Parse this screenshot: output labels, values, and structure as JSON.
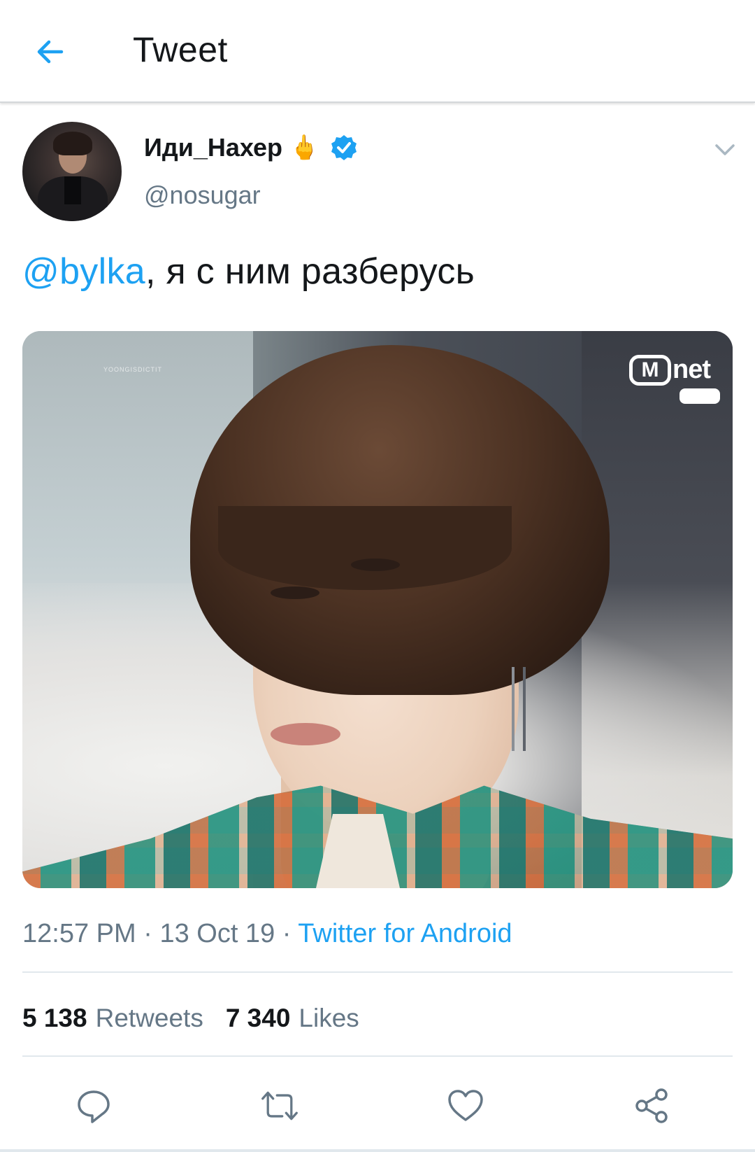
{
  "header": {
    "title": "Tweet"
  },
  "tweet": {
    "author": {
      "display_name": "Иди_Нахер",
      "emoji": "🖕",
      "handle": "@nosugar",
      "verified": true
    },
    "text": {
      "mention": "@bylka",
      "body": ", я с ним разберусь"
    },
    "media": {
      "logo_text": "Mnet",
      "logo_m": "M",
      "logo_net": "net",
      "watermark": "YOONGISDICTIT"
    },
    "meta": {
      "time": "12:57 PM",
      "separator": " · ",
      "date": "13 Oct 19",
      "source": "Twitter for Android"
    },
    "stats": {
      "retweets_count": "5 138",
      "retweets_label": "Retweets",
      "likes_count": "7 340",
      "likes_label": "Likes"
    }
  },
  "colors": {
    "accent": "#1da1f2",
    "text_primary": "#14171a",
    "text_secondary": "#657786",
    "divider": "#e1e8ed"
  },
  "icons": {
    "back": "arrow-left-icon",
    "verified": "verified-badge-icon",
    "caret": "chevron-down-icon",
    "reply": "reply-icon",
    "retweet": "retweet-icon",
    "like": "heart-icon",
    "share": "share-icon"
  }
}
